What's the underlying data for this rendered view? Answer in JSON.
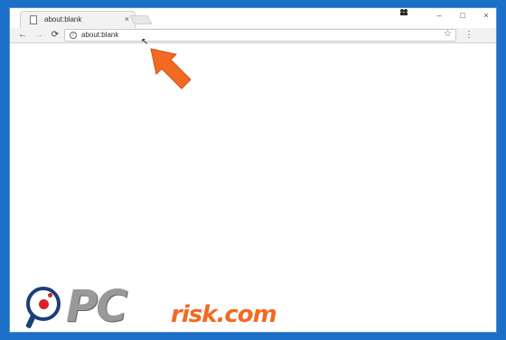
{
  "browser": {
    "tab": {
      "title": "about:blank",
      "close_label": "×"
    },
    "window_controls": {
      "minimize": "–",
      "maximize": "□",
      "close": "×"
    },
    "profile_icon": "person-icon",
    "toolbar": {
      "back": "←",
      "forward": "→",
      "reload": "⟳",
      "address": "about:blank",
      "bookmark": "☆",
      "menu": "⋮"
    },
    "cursor": "↖"
  },
  "overlay": {
    "arrow_color": "#f26a21",
    "arrow_direction": "up-left"
  },
  "watermark": {
    "pc_text": "PC",
    "risk_text": "risk.com",
    "brand_dark": "#1b3f78",
    "brand_red": "#d8232a",
    "brand_orange": "#f26a21",
    "brand_gray": "#999999"
  }
}
